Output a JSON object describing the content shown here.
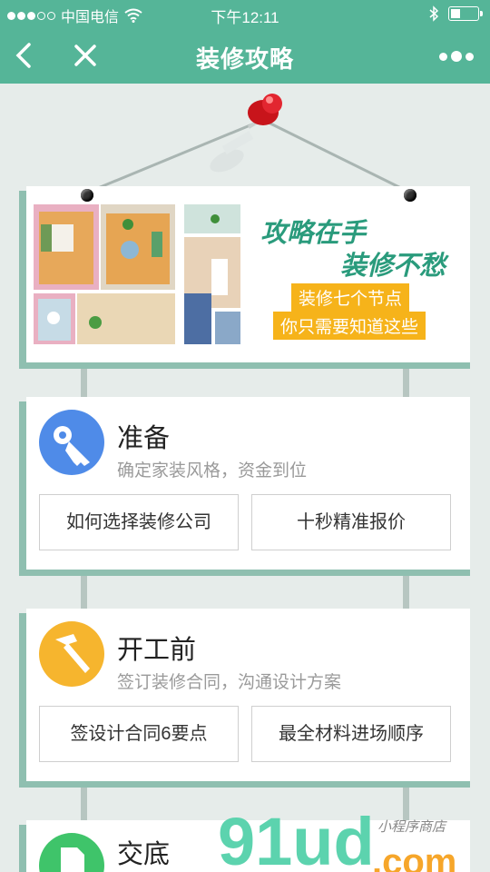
{
  "status_bar": {
    "carrier": "中国电信",
    "time": "下午12:11",
    "battery_level": 0.35
  },
  "nav": {
    "title": "装修攻略",
    "back_icon": "chevron-left-icon",
    "close_icon": "close-icon",
    "more_icon": "more-dots-icon"
  },
  "banner": {
    "headline_1": "攻略在手",
    "headline_2": "装修不愁",
    "tag_1": "装修七个节点",
    "tag_2": "你只需要知道这些"
  },
  "sections": [
    {
      "title": "准备",
      "subtitle": "确定家装风格，资金到位",
      "icon": "key-icon",
      "icon_color": "#4f8be8",
      "buttons": [
        "如何选择装修公司",
        "十秒精准报价"
      ]
    },
    {
      "title": "开工前",
      "subtitle": "签订装修合同，沟通设计方案",
      "icon": "hammer-icon",
      "icon_color": "#f6b52e",
      "buttons": [
        "签设计合同6要点",
        "最全材料进场顺序"
      ]
    },
    {
      "title": "交底",
      "icon": "document-icon",
      "icon_color": "#3fc46a"
    }
  ],
  "watermark": {
    "brand": "91ud",
    "suffix": ".com",
    "tagline": "小程序商店"
  },
  "colors": {
    "accent": "#55b598",
    "card_shadow": "#8fbfb0",
    "tag": "#f6b31a"
  }
}
